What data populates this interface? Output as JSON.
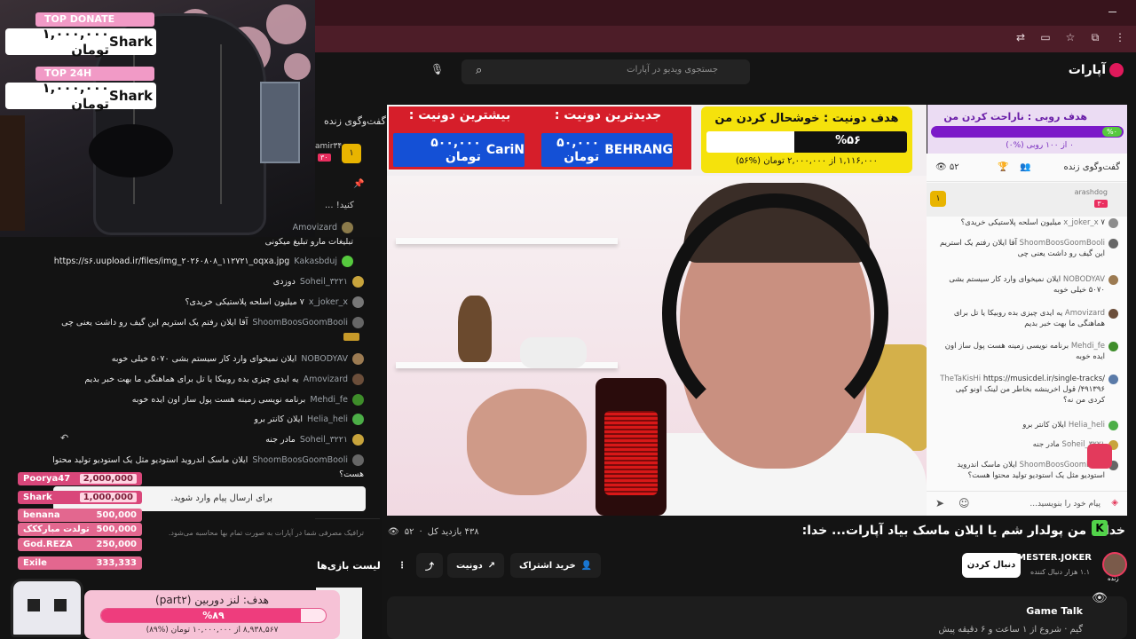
{
  "site": {
    "brand": "آپارات",
    "search_placeholder": "جستجوی ویدیو در آپارات"
  },
  "overlay_left": {
    "top_donate_label": "TOP DONATE",
    "top_donate_name": "Shark",
    "top_donate_amount": "۱,۰۰۰,۰۰۰ تومان",
    "top24_label": "TOP 24H",
    "top24_name": "Shark",
    "top24_amount": "۱,۰۰۰,۰۰۰ تومان"
  },
  "left_chat": {
    "title": "گفت‌وگوی زنده",
    "pinned_user": "amir۳۴۰",
    "pinned_count": "۳۰",
    "pinned_msg": "کنید! ...",
    "messages": [
      {
        "user": "Amovizard",
        "msg": ""
      },
      {
        "user": "",
        "msg": "تبلیغات مارو تبلیغ میکونی"
      },
      {
        "user": "Kakasbduj",
        "msg": "https://s۶.uupload.ir/files/img_۲۰۲۶۰۸۰۸_۱۱۲۷۲۱_oqxa.jpg"
      },
      {
        "user": "Soheil_۳۲۲۱",
        "msg": "دوزدی"
      },
      {
        "user": "x_joker_x",
        "msg": "۷ میلیون اسلحه پلاستیکی خریدی؟"
      },
      {
        "user": "ShoomBoosGoomBooli",
        "msg": "آقا ایلان رفتم یک استریم این گیف رو داشت یعنی چی"
      },
      {
        "user": "NOBODYAV",
        "msg": "ایلان نمیخوای وارد کار سیستم بشی ۵۰۷۰ خیلی خوبه"
      },
      {
        "user": "Amovizard",
        "msg": "یه ایدی چیزی بده روبیکا یا تل برای هماهنگی ما بهت خبر بدیم"
      },
      {
        "user": "Mehdi_fe",
        "msg": "برنامه نویسی زمینه هست پول ساز اون ایده خوبه"
      },
      {
        "user": "Helia_heli",
        "msg": "ایلان کانتر برو"
      },
      {
        "user": "Soheil_۳۲۲۱",
        "msg": "مادر جنه"
      },
      {
        "user": "ShoomBoosGoomBooli",
        "msg": "ایلان ماسک اندروید استودیو مثل یک استودیو تولید محتوا"
      },
      {
        "user": "",
        "msg": "هست؟"
      }
    ],
    "input_placeholder": "برای ارسال پیام وارد شوید.",
    "traffic_note": "ترافیک مصرفی شما در آپارات به صورت تمام بها محاسبه می‌شود.",
    "games_title": "لیست بازی‌ها"
  },
  "leaderboard": [
    {
      "name": "Poorya47",
      "amount": "2,000,000"
    },
    {
      "name": "Shark",
      "amount": "1,000,000"
    },
    {
      "name": "benana",
      "amount": "500,000"
    },
    {
      "name": "تولدت مبارککک",
      "amount": "500,000"
    },
    {
      "name": "God.REZA",
      "amount": "250,000"
    },
    {
      "name": "Exile",
      "amount": "333,333"
    }
  ],
  "goal_bottom": {
    "title": "هدف: لنز دوربین (part۲)",
    "percent_label": "%۸۹",
    "percent": 0.89,
    "sub": "۸,۹۳۸,۵۶۷ از ۱۰,۰۰۰,۰۰۰ تومان (%۸۹)"
  },
  "banner": {
    "most_title": "بیشترین دونیت :",
    "most_name": "CariN",
    "most_amount": "۵۰۰,۰۰۰ تومان",
    "latest_title": "جدیدترین دونیت :",
    "latest_name": "BEHRANG",
    "latest_amount": "۵۰,۰۰۰ تومان"
  },
  "goal_yellow": {
    "title": "هدف دونیت : خوشحال کردن من",
    "percent_label": "%۵۶",
    "percent": 0.56,
    "sub": "۱,۱۱۶,۰۰۰ از ۲,۰۰۰,۰۰۰ تومان (%۵۶)"
  },
  "goal_purple": {
    "title": "هدف روبی : ناراحت کردن من",
    "percent_label": "%۰",
    "sub": "۰ از ۱۰۰ روبی (%۰)"
  },
  "right_chat": {
    "tab_live": "گفت‌وگوی زنده",
    "viewers": "۵۲",
    "pinned_user": "arashdog",
    "pinned_count": "۳۰",
    "messages": [
      {
        "user": "x_joker_x",
        "msg": "۷ میلیون اسلحه پلاستیکی خریدی؟"
      },
      {
        "user": "ShoomBoosGoomBooli",
        "msg": "آقا ایلان رفتم یک استریم این گیف رو داشت یعنی چی"
      },
      {
        "user": "NOBODYAV",
        "msg": "ایلان نمیخوای وارد کار سیستم بشی ۵۰۷۰ خیلی خوبه"
      },
      {
        "user": "Amovizard",
        "msg": "یه ایدی چیزی بده روبیکا یا تل برای هماهنگی ما بهت خبر بدیم"
      },
      {
        "user": "Mehdi_fe",
        "msg": "برنامه نویسی زمینه هست پول ساز اون ایده خوبه"
      },
      {
        "user": "TheTaKisHi",
        "msg": "https://musicdel.ir/single-tracks/۴۹۱۳۹۶/ قول اخرینشه بخاطر من لینک اونو کپی کردی من نه؟"
      },
      {
        "user": "Helia_heli",
        "msg": "ایلان کانتر برو"
      },
      {
        "user": "Soheil_۳۲۲۱",
        "msg": "مادر جنه"
      },
      {
        "user": "ShoomBoosGoomBooli",
        "msg": "ایلان ماسک اندروید استودیو مثل یک استودیو تولید محتوا هست؟"
      }
    ],
    "input_placeholder": "پیام خود را بنویسید..."
  },
  "video_info": {
    "title": "خدا... من پولدار شم یا ایلان ماسک بیاد آپارات... خدا:",
    "views": "۴۳۸ بازدید کل",
    "viewers": "۵۲",
    "donate_btn": "دونیت",
    "subscribe_btn": "خرید اشتراک",
    "follow_btn": "دنبال کردن",
    "channel_name": "MESTER.JOKER",
    "channel_followers": "۱.۱ هزار دنبال کننده",
    "live_tag": "زنده",
    "category_title": "Game Talk",
    "category_sub": "گیم  ·  شروع از ۱ ساعت و ۶ دقیقه پیش"
  },
  "colors": {
    "accent": "#e0195b",
    "banner_red": "#d61e2a",
    "banner_blue": "#1450d6",
    "goal_yellow": "#f5e20c",
    "goal_pink": "#ee3d7d",
    "goal_purple": "#7b19c8"
  }
}
